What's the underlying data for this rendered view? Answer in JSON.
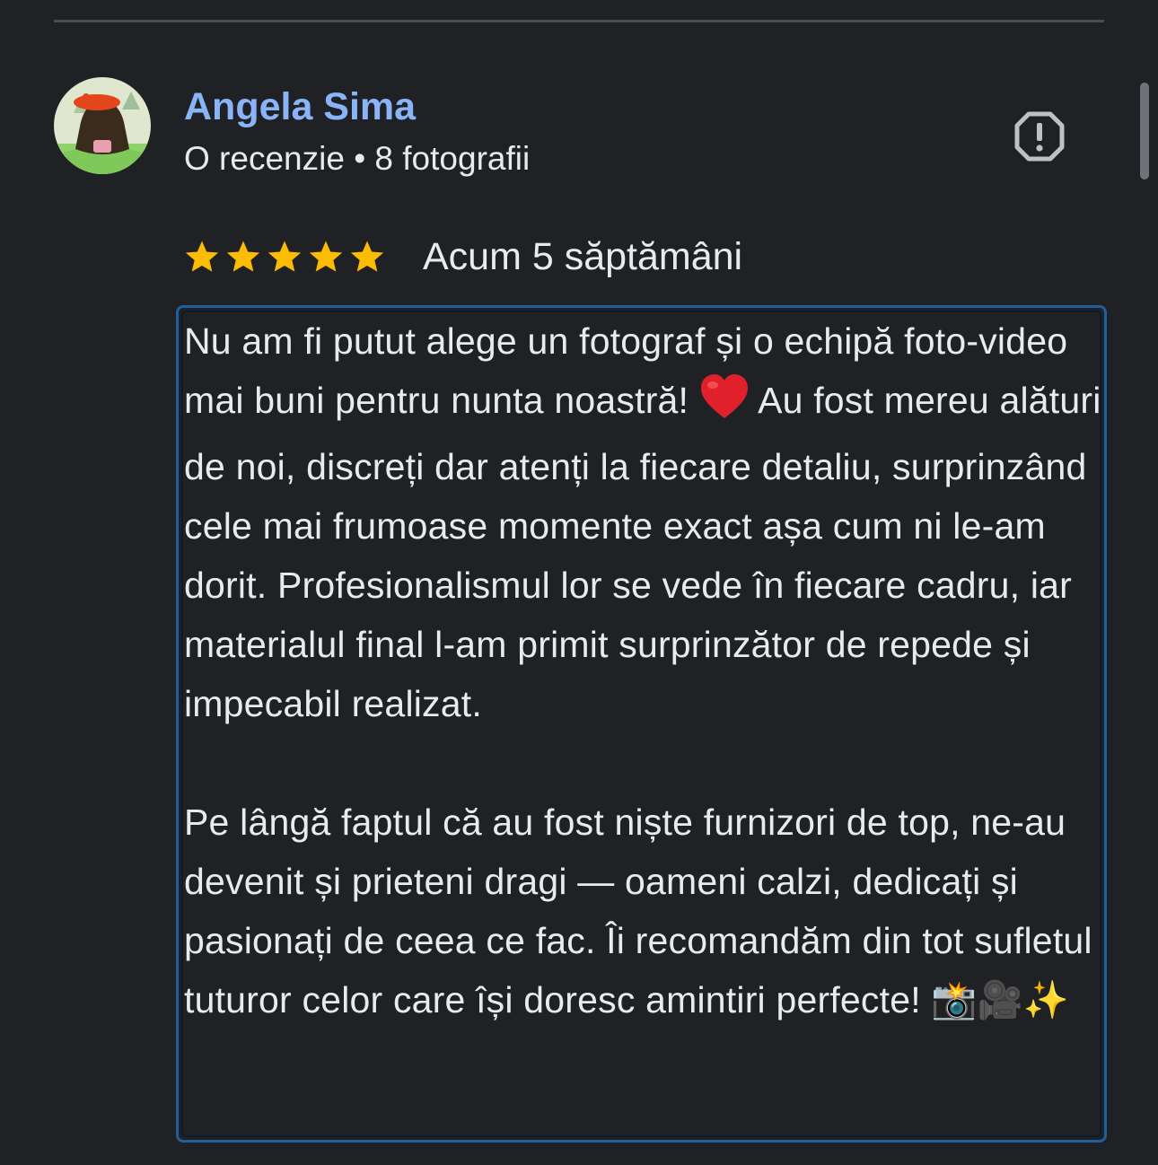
{
  "review": {
    "reviewer_name": "Angela Sima",
    "reviewer_meta": "O recenzie • 8 fotografii",
    "rating": 5,
    "rating_max": 5,
    "date": "Acum 5 săptămâni",
    "star_color": "#fbbc04",
    "name_color": "#8ab4f8",
    "report_icon": "report-flag-icon",
    "paragraphs": [
      {
        "before_heart": "Nu am fi putut alege un fotograf și o echipă foto-video mai buni pentru nunta noastră! ",
        "after_heart": " Au fost mereu alături de noi, discreți dar atenți la fiecare detaliu, surprinzând cele mai frumoase momente exact așa cum ni le-am dorit. Profesionalismul lor se vede în fiecare cadru, iar materialul final l-am primit surprinzător de repede și impecabil realizat."
      },
      {
        "text": "Pe lângă faptul că au fost niște furnizori de top, ne-au devenit și prieteni dragi — oameni calzi, dedicați și pasionați de ceea ce fac. Îi recomandăm din tot sufletul tuturor celor care își doresc amintiri perfecte! ",
        "emojis": "📸🎥✨"
      }
    ]
  }
}
